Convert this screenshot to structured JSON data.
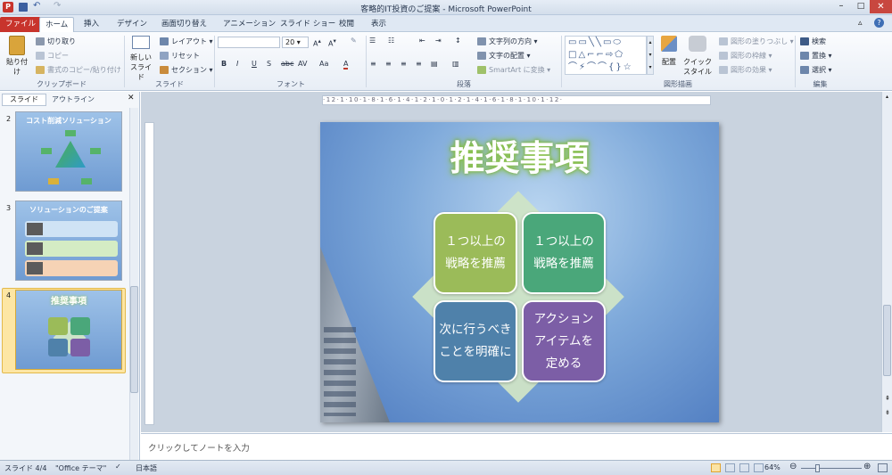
{
  "title_bar": {
    "title": "客略的IT投資のご提案 - Microsoft PowerPoint"
  },
  "tabs": [
    "ファイル",
    "ホーム",
    "挿入",
    "デザイン",
    "画面切り替え",
    "アニメーション",
    "スライド ショー",
    "校閲",
    "表示"
  ],
  "ribbon": {
    "clipboard": {
      "paste": "貼り付け",
      "cut": "切り取り",
      "copy": "コピー",
      "format_painter": "書式のコピー/貼り付け",
      "label": "クリップボード"
    },
    "slides": {
      "new_slide_1": "新しい",
      "new_slide_2": "スライド",
      "layout": "レイアウト",
      "reset": "リセット",
      "section": "セクション",
      "label": "スライド"
    },
    "font": {
      "size": "20",
      "label": "フォント"
    },
    "paragraph": {
      "text_direction": "文字列の方向",
      "align_text": "文字の配置",
      "smartart": "SmartArt に変換",
      "label": "段落"
    },
    "drawing": {
      "arrange": "配置",
      "quick_styles_1": "クイック",
      "quick_styles_2": "スタイル",
      "fill": "図形の塗りつぶし",
      "outline": "図形の枠線",
      "effects": "図形の効果",
      "label": "図形描画"
    },
    "editing": {
      "find": "検索",
      "replace": "置換",
      "select": "選択",
      "label": "編集"
    }
  },
  "panel": {
    "tab_slides": "スライド",
    "tab_outline": "アウトライン",
    "thumbnails": [
      {
        "number": "2",
        "title": "コスト削減ソリューション"
      },
      {
        "number": "3",
        "title": "ソリューションのご提案"
      },
      {
        "number": "4",
        "title": "推奨事項"
      }
    ]
  },
  "slide": {
    "title": "推奨事項",
    "boxes": [
      {
        "text": "１つ以上の\n戦略を推薦",
        "color": "#9bbb59"
      },
      {
        "text": "１つ以上の\n戦略を推薦",
        "color": "#4aa77a"
      },
      {
        "text": "次に行うべき\nことを明確に",
        "color": "#4f81aa"
      },
      {
        "text": "アクション\nアイテムを\n定める",
        "color": "#7c5ea6"
      }
    ]
  },
  "notes": {
    "placeholder": "クリックしてノートを入力"
  },
  "status": {
    "slide": "スライド 4/4",
    "theme": "\"Office テーマ\"",
    "language": "日本語",
    "zoom": "64%"
  }
}
